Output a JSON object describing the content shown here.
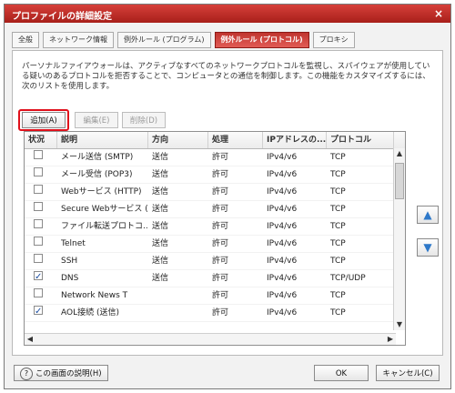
{
  "window": {
    "title": "プロファイルの詳細設定",
    "close_icon": "×"
  },
  "tabs": [
    {
      "label": "全般"
    },
    {
      "label": "ネットワーク情報"
    },
    {
      "label": "例外ルール (プログラム)"
    },
    {
      "label": "例外ルール (プロトコル)"
    },
    {
      "label": "プロキシ"
    }
  ],
  "description": "パーソナルファイアウォールは、アクティブなすべてのネットワークプロトコルを監視し、スパイウェアが使用している疑いのあるプロトコルを拒否することで、コンピュータとの通信を制御します。この機能をカスタマイズするには、次のリストを使用します。",
  "buttons": {
    "add": "追加(A)",
    "edit": "編集(E)",
    "delete": "削除(D)"
  },
  "table": {
    "headers": [
      "状況",
      "説明",
      "方向",
      "処理",
      "IPアドレスの...",
      "プロトコル"
    ],
    "rows": [
      {
        "checked": false,
        "description": "メール送信 (SMTP)",
        "direction": "送信",
        "action": "許可",
        "ip": "IPv4/v6",
        "protocol": "TCP"
      },
      {
        "checked": false,
        "description": "メール受信 (POP3)",
        "direction": "送信",
        "action": "許可",
        "ip": "IPv4/v6",
        "protocol": "TCP"
      },
      {
        "checked": false,
        "description": "Webサービス (HTTP)",
        "direction": "送信",
        "action": "許可",
        "ip": "IPv4/v6",
        "protocol": "TCP"
      },
      {
        "checked": false,
        "description": "Secure Webサービス (...",
        "direction": "送信",
        "action": "許可",
        "ip": "IPv4/v6",
        "protocol": "TCP"
      },
      {
        "checked": false,
        "description": "ファイル転送プロトコ...",
        "direction": "送信",
        "action": "許可",
        "ip": "IPv4/v6",
        "protocol": "TCP"
      },
      {
        "checked": false,
        "description": "Telnet",
        "direction": "送信",
        "action": "許可",
        "ip": "IPv4/v6",
        "protocol": "TCP"
      },
      {
        "checked": false,
        "description": "SSH",
        "direction": "送信",
        "action": "許可",
        "ip": "IPv4/v6",
        "protocol": "TCP"
      },
      {
        "checked": true,
        "description": "DNS",
        "direction": "送信",
        "action": "許可",
        "ip": "IPv4/v6",
        "protocol": "TCP/UDP"
      },
      {
        "checked": false,
        "description": "Network News T",
        "direction": "",
        "action": "許可",
        "ip": "IPv4/v6",
        "protocol": "TCP"
      },
      {
        "checked": true,
        "description": "AOL接続 (送信)",
        "direction": "",
        "action": "許可",
        "ip": "IPv4/v6",
        "protocol": "TCP"
      }
    ]
  },
  "side_buttons": {
    "up_icon": "▲",
    "down_icon": "▼"
  },
  "footer": {
    "help_icon": "?",
    "help": "この画面の説明(H)",
    "ok": "OK",
    "cancel": "キャンセル(C)"
  },
  "colors": {
    "title_red": "#c6302b",
    "highlight_red": "#e0101b"
  }
}
